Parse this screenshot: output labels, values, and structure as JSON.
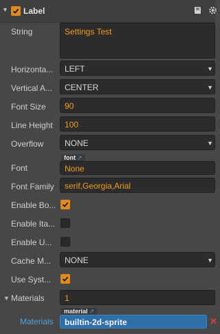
{
  "component": {
    "title": "Label",
    "enabled": true,
    "icons": [
      "book-icon",
      "gear-icon"
    ]
  },
  "props": {
    "string_label": "String",
    "string_value": "Settings Test",
    "horizontal_label": "Horizonta...",
    "horizontal_value": "LEFT",
    "vertical_label": "Vertical A...",
    "vertical_value": "CENTER",
    "font_size_label": "Font Size",
    "font_size_value": "90",
    "line_height_label": "Line Height",
    "line_height_value": "100",
    "overflow_label": "Overflow",
    "overflow_value": "NONE",
    "font_label": "Font",
    "font_tag": "font",
    "font_placeholder": "None",
    "font_family_label": "Font Family",
    "font_family_value": "serif,Georgia,Arial",
    "enable_bold_label": "Enable Bo...",
    "enable_bold": true,
    "enable_italic_label": "Enable Ita...",
    "enable_italic": false,
    "enable_underline_label": "Enable U...",
    "enable_underline": false,
    "cache_mode_label": "Cache M...",
    "cache_mode_value": "NONE",
    "use_system_font_label": "Use Syst...",
    "use_system_font": true
  },
  "materials": {
    "label": "Materials",
    "count": "1",
    "item_label": "Materials",
    "tag": "material",
    "value": "builtin-2d-sprite"
  },
  "colors": {
    "accent_orange": "#f29b22",
    "link_blue": "#4ea1e2",
    "selected_blue": "#2e6fa7",
    "panel_bg": "#474747",
    "field_bg": "#2c2c2c"
  }
}
